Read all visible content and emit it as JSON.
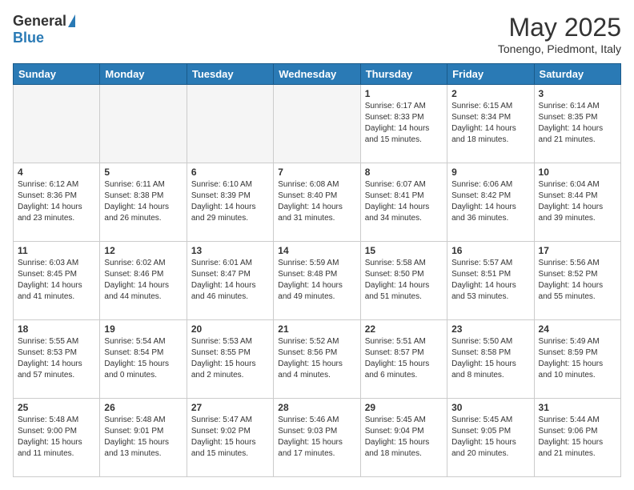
{
  "logo": {
    "general": "General",
    "blue": "Blue"
  },
  "title": "May 2025",
  "subtitle": "Tonengo, Piedmont, Italy",
  "days_of_week": [
    "Sunday",
    "Monday",
    "Tuesday",
    "Wednesday",
    "Thursday",
    "Friday",
    "Saturday"
  ],
  "weeks": [
    [
      {
        "day": "",
        "info": ""
      },
      {
        "day": "",
        "info": ""
      },
      {
        "day": "",
        "info": ""
      },
      {
        "day": "",
        "info": ""
      },
      {
        "day": "1",
        "info": "Sunrise: 6:17 AM\nSunset: 8:33 PM\nDaylight: 14 hours and 15 minutes."
      },
      {
        "day": "2",
        "info": "Sunrise: 6:15 AM\nSunset: 8:34 PM\nDaylight: 14 hours and 18 minutes."
      },
      {
        "day": "3",
        "info": "Sunrise: 6:14 AM\nSunset: 8:35 PM\nDaylight: 14 hours and 21 minutes."
      }
    ],
    [
      {
        "day": "4",
        "info": "Sunrise: 6:12 AM\nSunset: 8:36 PM\nDaylight: 14 hours and 23 minutes."
      },
      {
        "day": "5",
        "info": "Sunrise: 6:11 AM\nSunset: 8:38 PM\nDaylight: 14 hours and 26 minutes."
      },
      {
        "day": "6",
        "info": "Sunrise: 6:10 AM\nSunset: 8:39 PM\nDaylight: 14 hours and 29 minutes."
      },
      {
        "day": "7",
        "info": "Sunrise: 6:08 AM\nSunset: 8:40 PM\nDaylight: 14 hours and 31 minutes."
      },
      {
        "day": "8",
        "info": "Sunrise: 6:07 AM\nSunset: 8:41 PM\nDaylight: 14 hours and 34 minutes."
      },
      {
        "day": "9",
        "info": "Sunrise: 6:06 AM\nSunset: 8:42 PM\nDaylight: 14 hours and 36 minutes."
      },
      {
        "day": "10",
        "info": "Sunrise: 6:04 AM\nSunset: 8:44 PM\nDaylight: 14 hours and 39 minutes."
      }
    ],
    [
      {
        "day": "11",
        "info": "Sunrise: 6:03 AM\nSunset: 8:45 PM\nDaylight: 14 hours and 41 minutes."
      },
      {
        "day": "12",
        "info": "Sunrise: 6:02 AM\nSunset: 8:46 PM\nDaylight: 14 hours and 44 minutes."
      },
      {
        "day": "13",
        "info": "Sunrise: 6:01 AM\nSunset: 8:47 PM\nDaylight: 14 hours and 46 minutes."
      },
      {
        "day": "14",
        "info": "Sunrise: 5:59 AM\nSunset: 8:48 PM\nDaylight: 14 hours and 49 minutes."
      },
      {
        "day": "15",
        "info": "Sunrise: 5:58 AM\nSunset: 8:50 PM\nDaylight: 14 hours and 51 minutes."
      },
      {
        "day": "16",
        "info": "Sunrise: 5:57 AM\nSunset: 8:51 PM\nDaylight: 14 hours and 53 minutes."
      },
      {
        "day": "17",
        "info": "Sunrise: 5:56 AM\nSunset: 8:52 PM\nDaylight: 14 hours and 55 minutes."
      }
    ],
    [
      {
        "day": "18",
        "info": "Sunrise: 5:55 AM\nSunset: 8:53 PM\nDaylight: 14 hours and 57 minutes."
      },
      {
        "day": "19",
        "info": "Sunrise: 5:54 AM\nSunset: 8:54 PM\nDaylight: 15 hours and 0 minutes."
      },
      {
        "day": "20",
        "info": "Sunrise: 5:53 AM\nSunset: 8:55 PM\nDaylight: 15 hours and 2 minutes."
      },
      {
        "day": "21",
        "info": "Sunrise: 5:52 AM\nSunset: 8:56 PM\nDaylight: 15 hours and 4 minutes."
      },
      {
        "day": "22",
        "info": "Sunrise: 5:51 AM\nSunset: 8:57 PM\nDaylight: 15 hours and 6 minutes."
      },
      {
        "day": "23",
        "info": "Sunrise: 5:50 AM\nSunset: 8:58 PM\nDaylight: 15 hours and 8 minutes."
      },
      {
        "day": "24",
        "info": "Sunrise: 5:49 AM\nSunset: 8:59 PM\nDaylight: 15 hours and 10 minutes."
      }
    ],
    [
      {
        "day": "25",
        "info": "Sunrise: 5:48 AM\nSunset: 9:00 PM\nDaylight: 15 hours and 11 minutes."
      },
      {
        "day": "26",
        "info": "Sunrise: 5:48 AM\nSunset: 9:01 PM\nDaylight: 15 hours and 13 minutes."
      },
      {
        "day": "27",
        "info": "Sunrise: 5:47 AM\nSunset: 9:02 PM\nDaylight: 15 hours and 15 minutes."
      },
      {
        "day": "28",
        "info": "Sunrise: 5:46 AM\nSunset: 9:03 PM\nDaylight: 15 hours and 17 minutes."
      },
      {
        "day": "29",
        "info": "Sunrise: 5:45 AM\nSunset: 9:04 PM\nDaylight: 15 hours and 18 minutes."
      },
      {
        "day": "30",
        "info": "Sunrise: 5:45 AM\nSunset: 9:05 PM\nDaylight: 15 hours and 20 minutes."
      },
      {
        "day": "31",
        "info": "Sunrise: 5:44 AM\nSunset: 9:06 PM\nDaylight: 15 hours and 21 minutes."
      }
    ]
  ]
}
